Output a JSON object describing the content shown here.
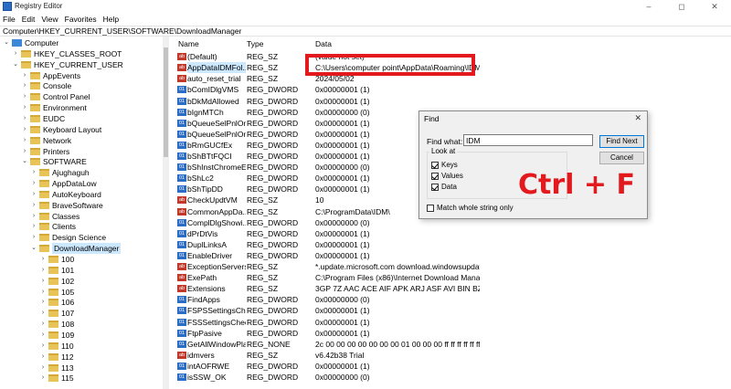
{
  "window": {
    "title": "Registry Editor",
    "minimize": "–",
    "maximize": "◻",
    "close": "✕"
  },
  "menu": [
    "File",
    "Edit",
    "View",
    "Favorites",
    "Help"
  ],
  "address": "Computer\\HKEY_CURRENT_USER\\SOFTWARE\\DownloadManager",
  "tree": {
    "root": "Computer",
    "hives": [
      "HKEY_CLASSES_ROOT",
      "HKEY_CURRENT_USER"
    ],
    "hkcu_children_top": [
      "AppEvents",
      "Console",
      "Control Panel",
      "Environment",
      "EUDC",
      "Keyboard Layout",
      "Network",
      "Printers"
    ],
    "software_label": "SOFTWARE",
    "software_children": [
      "Ajughaguh",
      "AppDataLow",
      "AutoKeyboard",
      "BraveSoftware",
      "Classes",
      "Clients",
      "Design Science",
      "DownloadManager"
    ],
    "downloadmanager_children": [
      "100",
      "101",
      "102",
      "105",
      "106",
      "107",
      "108",
      "109",
      "110",
      "112",
      "113",
      "115"
    ]
  },
  "columns": {
    "name": "Name",
    "type": "Type",
    "data": "Data"
  },
  "values": [
    {
      "name": "(Default)",
      "type": "REG_SZ",
      "data": "(value not set)",
      "kind": "sz"
    },
    {
      "name": "AppDataIDMFol...",
      "type": "REG_SZ",
      "data": "C:\\Users\\computer point\\AppData\\Roaming\\IDM\\",
      "kind": "sz"
    },
    {
      "name": "auto_reset_trial",
      "type": "REG_SZ",
      "data": "2024/05/02",
      "kind": "sz"
    },
    {
      "name": "bComIDlgVMS",
      "type": "REG_DWORD",
      "data": "0x00000001 (1)",
      "kind": "dw"
    },
    {
      "name": "bDkMdAllowed",
      "type": "REG_DWORD",
      "data": "0x00000001 (1)",
      "kind": "dw"
    },
    {
      "name": "bIgnMTCh",
      "type": "REG_DWORD",
      "data": "0x00000000 (0)",
      "kind": "dw"
    },
    {
      "name": "bQueueSelPnlOn...",
      "type": "REG_DWORD",
      "data": "0x00000001 (1)",
      "kind": "dw"
    },
    {
      "name": "bQueueSelPnlOn...",
      "type": "REG_DWORD",
      "data": "0x00000001 (1)",
      "kind": "dw"
    },
    {
      "name": "bRmGUCfEx",
      "type": "REG_DWORD",
      "data": "0x00000001 (1)",
      "kind": "dw"
    },
    {
      "name": "bShBTtFQCI",
      "type": "REG_DWORD",
      "data": "0x00000001 (1)",
      "kind": "dw"
    },
    {
      "name": "bShInstChromeE...",
      "type": "REG_DWORD",
      "data": "0x00000000 (0)",
      "kind": "dw"
    },
    {
      "name": "bShLc2",
      "type": "REG_DWORD",
      "data": "0x00000001 (1)",
      "kind": "dw"
    },
    {
      "name": "bShTipDD",
      "type": "REG_DWORD",
      "data": "0x00000001 (1)",
      "kind": "dw"
    },
    {
      "name": "CheckUpdtVM",
      "type": "REG_SZ",
      "data": "10",
      "kind": "sz"
    },
    {
      "name": "CommonAppDa...",
      "type": "REG_SZ",
      "data": "C:\\ProgramData\\IDM\\",
      "kind": "sz"
    },
    {
      "name": "ComplDlgShowi...",
      "type": "REG_DWORD",
      "data": "0x00000000 (0)",
      "kind": "dw"
    },
    {
      "name": "dPrDtVis",
      "type": "REG_DWORD",
      "data": "0x00000001 (1)",
      "kind": "dw"
    },
    {
      "name": "DuplLinksA",
      "type": "REG_DWORD",
      "data": "0x00000001 (1)",
      "kind": "dw"
    },
    {
      "name": "EnableDriver",
      "type": "REG_DWORD",
      "data": "0x00000001 (1)",
      "kind": "dw"
    },
    {
      "name": "ExceptionServers",
      "type": "REG_SZ",
      "data": "*.update.microsoft.com download.windowsupdate....",
      "kind": "sz"
    },
    {
      "name": "ExePath",
      "type": "REG_SZ",
      "data": "C:\\Program Files (x86)\\Internet Download Manager...",
      "kind": "sz"
    },
    {
      "name": "Extensions",
      "type": "REG_SZ",
      "data": "3GP 7Z AAC ACE AIF APK ARJ ASF AVI BIN BZ2 EXE...",
      "kind": "sz"
    },
    {
      "name": "FindApps",
      "type": "REG_DWORD",
      "data": "0x00000000 (0)",
      "kind": "dw"
    },
    {
      "name": "FSPSSettingsChe...",
      "type": "REG_DWORD",
      "data": "0x00000001 (1)",
      "kind": "dw"
    },
    {
      "name": "FSSSettingsCheck...",
      "type": "REG_DWORD",
      "data": "0x00000001 (1)",
      "kind": "dw"
    },
    {
      "name": "FtpPasive",
      "type": "REG_DWORD",
      "data": "0x00000001 (1)",
      "kind": "dw"
    },
    {
      "name": "GetAllWindowPla...",
      "type": "REG_NONE",
      "data": "2c 00 00 00 00 00 00 00 01 00 00 00 ff ff ff ff ff ff f...",
      "kind": "dw"
    },
    {
      "name": "idmvers",
      "type": "REG_SZ",
      "data": "v6.42b38 Trial",
      "kind": "sz"
    },
    {
      "name": "intAOFRWE",
      "type": "REG_DWORD",
      "data": "0x00000001 (1)",
      "kind": "dw"
    },
    {
      "name": "isSSW_OK",
      "type": "REG_DWORD",
      "data": "0x00000000 (0)",
      "kind": "dw"
    }
  ],
  "find_dialog": {
    "title": "Find",
    "close": "✕",
    "find_what_label": "Find what:",
    "find_what_value": "IDM",
    "find_next": "Find Next",
    "cancel": "Cancel",
    "look_at": "Look at",
    "keys": "Keys",
    "values": "Values",
    "data": "Data",
    "match_whole": "Match whole string only"
  },
  "overlay_text": "Ctrl + F",
  "colors": {
    "highlight": "#e3191e",
    "selection": "#cce8ff"
  }
}
